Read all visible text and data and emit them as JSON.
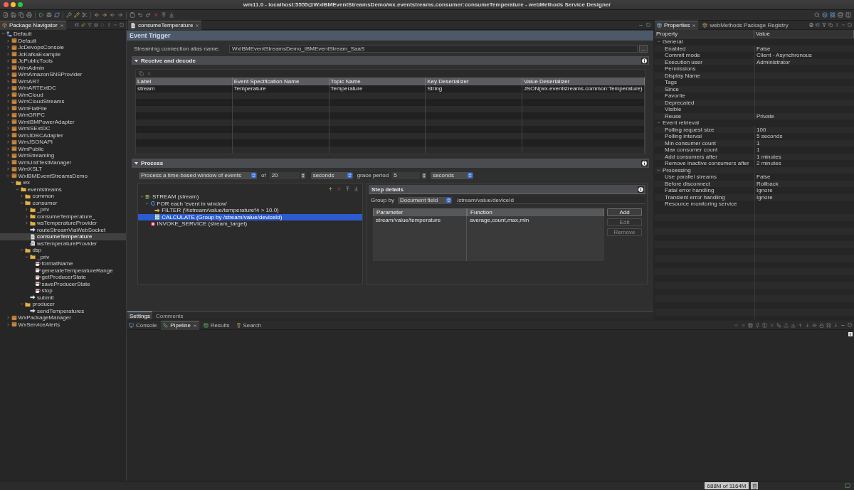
{
  "window": {
    "title": "wm11.0 - localhost:5555@WxIBMEventStreamsDemo/wx.eventstreams.consumer:consumeTemperature - webMethods Service Designer"
  },
  "navigator": {
    "tab": {
      "label": "Package Navigator",
      "selected": true
    },
    "tree": [
      {
        "label": "Default",
        "kind": "server",
        "expanded": true,
        "selected": false,
        "children": [
          {
            "label": "Default",
            "kind": "package",
            "expanded": false,
            "selected": false
          },
          {
            "label": "JcDevopsConsole",
            "kind": "package",
            "expanded": false,
            "selected": false
          },
          {
            "label": "JcKafkaExample",
            "kind": "package",
            "expanded": false,
            "selected": false
          },
          {
            "label": "JcPublicTools",
            "kind": "package",
            "expanded": false,
            "selected": false
          },
          {
            "label": "WmAdmin",
            "kind": "package",
            "expanded": false,
            "selected": false
          },
          {
            "label": "WmAmazonSNSProvider",
            "kind": "package",
            "expanded": false,
            "selected": false
          },
          {
            "label": "WmART",
            "kind": "package",
            "expanded": false,
            "selected": false
          },
          {
            "label": "WmARTExtDC",
            "kind": "package",
            "expanded": false,
            "selected": false
          },
          {
            "label": "WmCloud",
            "kind": "package",
            "expanded": false,
            "selected": false
          },
          {
            "label": "WmCloudStreams",
            "kind": "package",
            "expanded": false,
            "selected": false
          },
          {
            "label": "WmFlatFile",
            "kind": "package",
            "expanded": false,
            "selected": false
          },
          {
            "label": "WmGRPC",
            "kind": "package",
            "expanded": false,
            "selected": false
          },
          {
            "label": "WmIBMPowerAdapter",
            "kind": "package",
            "expanded": false,
            "selected": false
          },
          {
            "label": "WmISExtDC",
            "kind": "package",
            "expanded": false,
            "selected": false
          },
          {
            "label": "WmJDBCAdapter",
            "kind": "package",
            "expanded": false,
            "selected": false
          },
          {
            "label": "WmJSONAPI",
            "kind": "package",
            "expanded": false,
            "selected": false
          },
          {
            "label": "WmPublic",
            "kind": "package",
            "expanded": false,
            "selected": false
          },
          {
            "label": "WmStreaming",
            "kind": "package",
            "expanded": false,
            "selected": false
          },
          {
            "label": "WmUnitTestManager",
            "kind": "package",
            "expanded": false,
            "selected": false
          },
          {
            "label": "WmXSLT",
            "kind": "package",
            "expanded": false,
            "selected": false
          },
          {
            "label": "WxIBMEventStreamsDemo",
            "kind": "package",
            "expanded": true,
            "selected": false,
            "children": [
              {
                "label": "wx",
                "kind": "folder",
                "expanded": true,
                "selected": false,
                "children": [
                  {
                    "label": "eventstreams",
                    "kind": "folder",
                    "expanded": true,
                    "selected": false,
                    "children": [
                      {
                        "label": "common",
                        "kind": "folder",
                        "expanded": false,
                        "selected": false
                      },
                      {
                        "label": "consumer",
                        "kind": "folder",
                        "expanded": true,
                        "selected": false,
                        "children": [
                          {
                            "label": "_priv",
                            "kind": "folder",
                            "expanded": false,
                            "selected": false
                          },
                          {
                            "label": "consumeTemperature_",
                            "kind": "folder",
                            "expanded": false,
                            "selected": false
                          },
                          {
                            "label": "wsTemperatureProvider",
                            "kind": "folder",
                            "expanded": false,
                            "selected": false
                          },
                          {
                            "label": "routeStreamViaWebSocket",
                            "kind": "flow",
                            "selected": false
                          },
                          {
                            "label": "consumeTemperature",
                            "kind": "trigger",
                            "selected": true
                          },
                          {
                            "label": "wsTemperatureProvider",
                            "kind": "websocket",
                            "selected": false
                          }
                        ]
                      },
                      {
                        "label": "dsp",
                        "kind": "folder",
                        "expanded": true,
                        "selected": false,
                        "children": [
                          {
                            "label": "_priv",
                            "kind": "folder",
                            "expanded": true,
                            "selected": false,
                            "children": [
                              {
                                "label": "formatName",
                                "kind": "java",
                                "selected": false
                              },
                              {
                                "label": "generateTemperatureRange",
                                "kind": "java",
                                "selected": false
                              },
                              {
                                "label": "getProducerState",
                                "kind": "java",
                                "selected": false
                              },
                              {
                                "label": "saveProducerState",
                                "kind": "java",
                                "selected": false
                              },
                              {
                                "label": "stop",
                                "kind": "java",
                                "selected": false
                              }
                            ]
                          },
                          {
                            "label": "submit",
                            "kind": "flow",
                            "selected": false
                          }
                        ]
                      },
                      {
                        "label": "producer",
                        "kind": "folder",
                        "expanded": true,
                        "selected": false,
                        "children": [
                          {
                            "label": "sendTemperatures",
                            "kind": "flow",
                            "selected": false
                          }
                        ]
                      }
                    ]
                  }
                ]
              }
            ]
          },
          {
            "label": "WxPackageManager",
            "kind": "package",
            "expanded": false,
            "selected": false
          },
          {
            "label": "WxServiceAlerts",
            "kind": "package",
            "expanded": false,
            "selected": false
          }
        ]
      }
    ]
  },
  "editor": {
    "tabs": [
      {
        "label": "consumeTemperature",
        "selected": true
      }
    ],
    "title": "Event Trigger",
    "connection": {
      "label": "Streaming connection alias name:",
      "value": "WxIBMEventStreamsDemo_IBMEventStream_SaaS",
      "button": "..."
    },
    "receive": {
      "title": "Receive and decode",
      "expanded": true,
      "table": {
        "columns": [
          "Label",
          "Event Specification Name",
          "Topic Name",
          "Key Deserializer",
          "Value Deserializer"
        ],
        "rows": [
          [
            "stream",
            "Temperature",
            "Temperature",
            "String",
            "JSON(wx.eventstreams.common:Temperature)"
          ]
        ]
      }
    },
    "process": {
      "title": "Process",
      "expanded": true,
      "window_mode": "Process a time-based window of events",
      "of_label": "of",
      "size": "20",
      "size_unit": "seconds",
      "grace_label": "grace period",
      "grace": "5",
      "grace_unit": "seconds",
      "steps": [
        {
          "label": "STREAM (stream)",
          "kind": "stream",
          "expanded": true,
          "selected": false,
          "children": [
            {
              "label": "FOR each 'event in window'",
              "kind": "loop",
              "expanded": true,
              "selected": false,
              "children": [
                {
                  "label": "FILTER (%stream/value/temperature% > 10.0)",
                  "kind": "filter",
                  "selected": false
                },
                {
                  "label": "CALCULATE (Group by /stream/value/deviceId)",
                  "kind": "calculate",
                  "selected": true
                }
              ]
            },
            {
              "label": "INVOKE_SERVICE (stream_target)",
              "kind": "invoke",
              "selected": false
            }
          ]
        }
      ],
      "step_details": {
        "title": "Step details",
        "group_by_label": "Group by",
        "group_by": "Document field",
        "group_path": "/stream/value/deviceId",
        "table": {
          "columns": [
            "Parameter",
            "Function"
          ],
          "rows": [
            [
              "stream/value/temperature",
              "average,count,max,min"
            ]
          ]
        },
        "buttons": [
          {
            "label": "Add",
            "disabled": false
          },
          {
            "label": "Edit",
            "disabled": true
          },
          {
            "label": "Remove",
            "disabled": true
          }
        ]
      }
    },
    "bottom_tabs": [
      {
        "label": "Settings",
        "selected": true
      },
      {
        "label": "Comments",
        "selected": false
      }
    ]
  },
  "properties": {
    "tabs": [
      {
        "label": "Properties",
        "selected": true
      },
      {
        "label": "webMethods Package Registry",
        "selected": false
      }
    ],
    "columns": [
      "Property",
      "Value"
    ],
    "groups": [
      {
        "name": "General",
        "expanded": true,
        "rows": [
          {
            "name": "Enabled",
            "value": "False"
          },
          {
            "name": "Commit mode",
            "value": "Client - Asynchronous"
          },
          {
            "name": "Execution user",
            "value": "Administrator"
          },
          {
            "name": "Permissions"
          },
          {
            "name": "Display Name"
          },
          {
            "name": "Tags"
          },
          {
            "name": "Since"
          },
          {
            "name": "Favorite"
          },
          {
            "name": "Deprecated"
          },
          {
            "name": "Visible"
          },
          {
            "name": "Reuse",
            "value": "Private"
          }
        ]
      },
      {
        "name": "Event retrieval",
        "expanded": true,
        "rows": [
          {
            "name": "Polling request size",
            "value": "100"
          },
          {
            "name": "Polling interval",
            "value": "5 seconds"
          },
          {
            "name": "Min consumer count",
            "value": "1"
          },
          {
            "name": "Max consumer count",
            "value": "1"
          },
          {
            "name": "Add consumers after",
            "value": "1 minutes"
          },
          {
            "name": "Remove inactive consumers after",
            "value": "2 minutes"
          }
        ]
      },
      {
        "name": "Processing",
        "expanded": true,
        "rows": [
          {
            "name": "Use parallel streams",
            "value": "False"
          },
          {
            "name": "Before disconnect",
            "value": "Rollback"
          },
          {
            "name": "Fatal error handling",
            "value": "Ignore"
          },
          {
            "name": "Transient error handling",
            "value": "Ignore"
          },
          {
            "name": "Resource monitoring service"
          }
        ]
      }
    ]
  },
  "console": {
    "tabs": [
      {
        "label": "Console",
        "selected": false
      },
      {
        "label": "Pipeline",
        "selected": true
      },
      {
        "label": "Results",
        "selected": false
      },
      {
        "label": "Search",
        "selected": false
      }
    ]
  },
  "status_bar": {
    "heap": "688M of 1164M"
  }
}
